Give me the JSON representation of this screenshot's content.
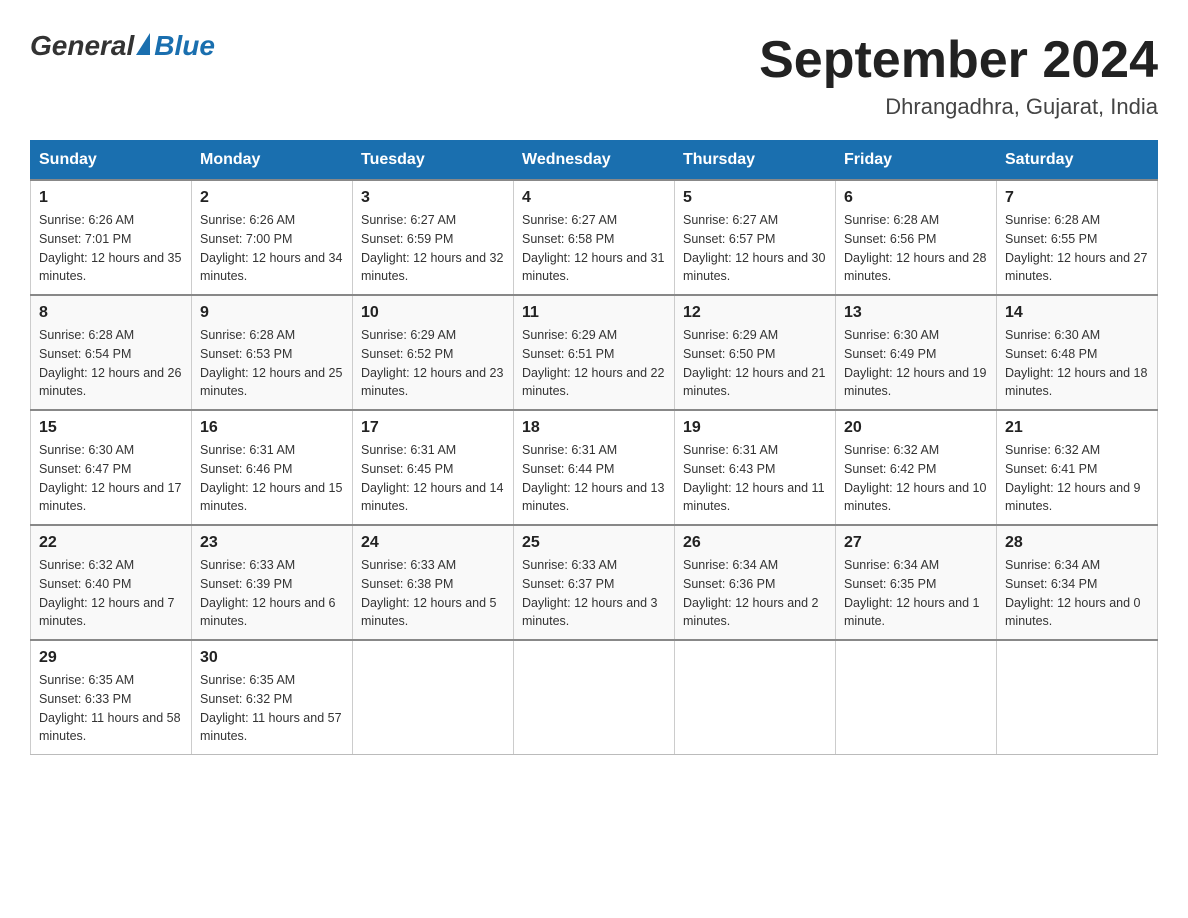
{
  "header": {
    "logo": {
      "general": "General",
      "blue": "Blue"
    },
    "title": "September 2024",
    "location": "Dhrangadhra, Gujarat, India"
  },
  "days_of_week": [
    "Sunday",
    "Monday",
    "Tuesday",
    "Wednesday",
    "Thursday",
    "Friday",
    "Saturday"
  ],
  "weeks": [
    [
      {
        "day": "1",
        "sunrise": "Sunrise: 6:26 AM",
        "sunset": "Sunset: 7:01 PM",
        "daylight": "Daylight: 12 hours and 35 minutes."
      },
      {
        "day": "2",
        "sunrise": "Sunrise: 6:26 AM",
        "sunset": "Sunset: 7:00 PM",
        "daylight": "Daylight: 12 hours and 34 minutes."
      },
      {
        "day": "3",
        "sunrise": "Sunrise: 6:27 AM",
        "sunset": "Sunset: 6:59 PM",
        "daylight": "Daylight: 12 hours and 32 minutes."
      },
      {
        "day": "4",
        "sunrise": "Sunrise: 6:27 AM",
        "sunset": "Sunset: 6:58 PM",
        "daylight": "Daylight: 12 hours and 31 minutes."
      },
      {
        "day": "5",
        "sunrise": "Sunrise: 6:27 AM",
        "sunset": "Sunset: 6:57 PM",
        "daylight": "Daylight: 12 hours and 30 minutes."
      },
      {
        "day": "6",
        "sunrise": "Sunrise: 6:28 AM",
        "sunset": "Sunset: 6:56 PM",
        "daylight": "Daylight: 12 hours and 28 minutes."
      },
      {
        "day": "7",
        "sunrise": "Sunrise: 6:28 AM",
        "sunset": "Sunset: 6:55 PM",
        "daylight": "Daylight: 12 hours and 27 minutes."
      }
    ],
    [
      {
        "day": "8",
        "sunrise": "Sunrise: 6:28 AM",
        "sunset": "Sunset: 6:54 PM",
        "daylight": "Daylight: 12 hours and 26 minutes."
      },
      {
        "day": "9",
        "sunrise": "Sunrise: 6:28 AM",
        "sunset": "Sunset: 6:53 PM",
        "daylight": "Daylight: 12 hours and 25 minutes."
      },
      {
        "day": "10",
        "sunrise": "Sunrise: 6:29 AM",
        "sunset": "Sunset: 6:52 PM",
        "daylight": "Daylight: 12 hours and 23 minutes."
      },
      {
        "day": "11",
        "sunrise": "Sunrise: 6:29 AM",
        "sunset": "Sunset: 6:51 PM",
        "daylight": "Daylight: 12 hours and 22 minutes."
      },
      {
        "day": "12",
        "sunrise": "Sunrise: 6:29 AM",
        "sunset": "Sunset: 6:50 PM",
        "daylight": "Daylight: 12 hours and 21 minutes."
      },
      {
        "day": "13",
        "sunrise": "Sunrise: 6:30 AM",
        "sunset": "Sunset: 6:49 PM",
        "daylight": "Daylight: 12 hours and 19 minutes."
      },
      {
        "day": "14",
        "sunrise": "Sunrise: 6:30 AM",
        "sunset": "Sunset: 6:48 PM",
        "daylight": "Daylight: 12 hours and 18 minutes."
      }
    ],
    [
      {
        "day": "15",
        "sunrise": "Sunrise: 6:30 AM",
        "sunset": "Sunset: 6:47 PM",
        "daylight": "Daylight: 12 hours and 17 minutes."
      },
      {
        "day": "16",
        "sunrise": "Sunrise: 6:31 AM",
        "sunset": "Sunset: 6:46 PM",
        "daylight": "Daylight: 12 hours and 15 minutes."
      },
      {
        "day": "17",
        "sunrise": "Sunrise: 6:31 AM",
        "sunset": "Sunset: 6:45 PM",
        "daylight": "Daylight: 12 hours and 14 minutes."
      },
      {
        "day": "18",
        "sunrise": "Sunrise: 6:31 AM",
        "sunset": "Sunset: 6:44 PM",
        "daylight": "Daylight: 12 hours and 13 minutes."
      },
      {
        "day": "19",
        "sunrise": "Sunrise: 6:31 AM",
        "sunset": "Sunset: 6:43 PM",
        "daylight": "Daylight: 12 hours and 11 minutes."
      },
      {
        "day": "20",
        "sunrise": "Sunrise: 6:32 AM",
        "sunset": "Sunset: 6:42 PM",
        "daylight": "Daylight: 12 hours and 10 minutes."
      },
      {
        "day": "21",
        "sunrise": "Sunrise: 6:32 AM",
        "sunset": "Sunset: 6:41 PM",
        "daylight": "Daylight: 12 hours and 9 minutes."
      }
    ],
    [
      {
        "day": "22",
        "sunrise": "Sunrise: 6:32 AM",
        "sunset": "Sunset: 6:40 PM",
        "daylight": "Daylight: 12 hours and 7 minutes."
      },
      {
        "day": "23",
        "sunrise": "Sunrise: 6:33 AM",
        "sunset": "Sunset: 6:39 PM",
        "daylight": "Daylight: 12 hours and 6 minutes."
      },
      {
        "day": "24",
        "sunrise": "Sunrise: 6:33 AM",
        "sunset": "Sunset: 6:38 PM",
        "daylight": "Daylight: 12 hours and 5 minutes."
      },
      {
        "day": "25",
        "sunrise": "Sunrise: 6:33 AM",
        "sunset": "Sunset: 6:37 PM",
        "daylight": "Daylight: 12 hours and 3 minutes."
      },
      {
        "day": "26",
        "sunrise": "Sunrise: 6:34 AM",
        "sunset": "Sunset: 6:36 PM",
        "daylight": "Daylight: 12 hours and 2 minutes."
      },
      {
        "day": "27",
        "sunrise": "Sunrise: 6:34 AM",
        "sunset": "Sunset: 6:35 PM",
        "daylight": "Daylight: 12 hours and 1 minute."
      },
      {
        "day": "28",
        "sunrise": "Sunrise: 6:34 AM",
        "sunset": "Sunset: 6:34 PM",
        "daylight": "Daylight: 12 hours and 0 minutes."
      }
    ],
    [
      {
        "day": "29",
        "sunrise": "Sunrise: 6:35 AM",
        "sunset": "Sunset: 6:33 PM",
        "daylight": "Daylight: 11 hours and 58 minutes."
      },
      {
        "day": "30",
        "sunrise": "Sunrise: 6:35 AM",
        "sunset": "Sunset: 6:32 PM",
        "daylight": "Daylight: 11 hours and 57 minutes."
      },
      null,
      null,
      null,
      null,
      null
    ]
  ]
}
